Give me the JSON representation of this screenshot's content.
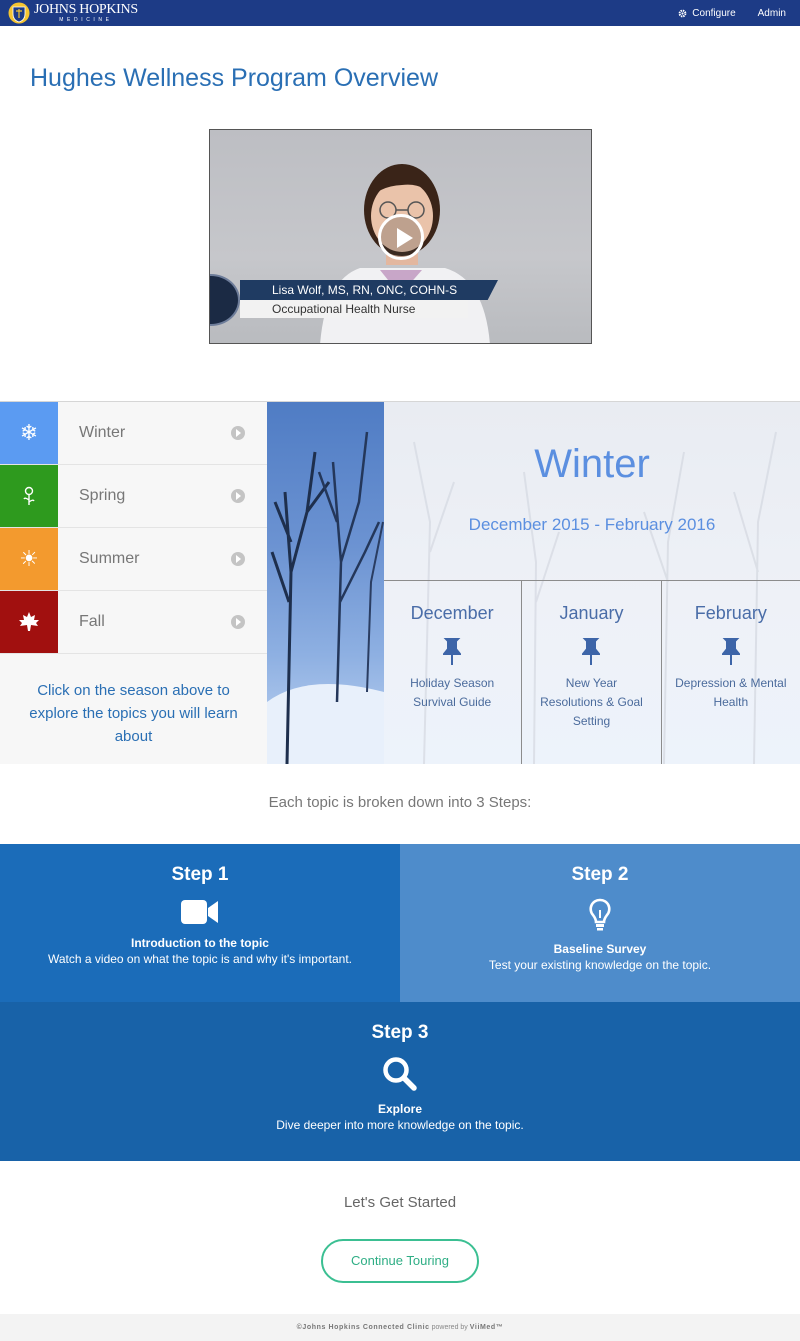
{
  "header": {
    "logo_line1": "JOHNS HOPKINS",
    "logo_line2": "MEDICINE",
    "nav": [
      {
        "label": "Configure",
        "icon": "gear-icon"
      },
      {
        "label": "Admin"
      }
    ]
  },
  "page": {
    "title": "Hughes Wellness Program Overview"
  },
  "video": {
    "presenter_name": "Lisa Wolf, MS, RN, ONC, COHN-S",
    "presenter_role": "Occupational Health Nurse",
    "play_icon": "play-icon"
  },
  "seasons": {
    "items": [
      {
        "label": "Winter",
        "color": "#5b9bf2",
        "icon": "snowflake-icon",
        "glyph": "❄"
      },
      {
        "label": "Spring",
        "color": "#2e9a1e",
        "icon": "sprout-icon",
        "glyph": "🌱"
      },
      {
        "label": "Summer",
        "color": "#f39a2e",
        "icon": "sun-icon",
        "glyph": "☀"
      },
      {
        "label": "Fall",
        "color": "#a1100f",
        "icon": "maple-leaf-icon",
        "glyph": "🍁"
      }
    ],
    "hint": "Click on the season above to explore the topics you will learn about",
    "selected": {
      "title": "Winter",
      "range": "December 2015 - February 2016",
      "months": [
        {
          "name": "December",
          "topic": "Holiday Season Survival Guide"
        },
        {
          "name": "January",
          "topic": "New Year Resolutions & Goal Setting"
        },
        {
          "name": "February",
          "topic": "Depression & Mental Health"
        }
      ]
    }
  },
  "steps": {
    "intro": "Each topic is broken down into 3 Steps:",
    "items": [
      {
        "heading": "Step 1",
        "title": "Introduction to the topic",
        "desc": "Watch a video on what the topic is and why it's important.",
        "icon": "video-camera-icon"
      },
      {
        "heading": "Step 2",
        "title": "Baseline Survey",
        "desc": "Test your existing knowledge on the topic.",
        "icon": "lightbulb-icon"
      },
      {
        "heading": "Step 3",
        "title": "Explore",
        "desc": "Dive deeper into more knowledge on the topic.",
        "icon": "search-icon"
      }
    ]
  },
  "cta": {
    "heading": "Let's Get Started",
    "button": "Continue Touring"
  },
  "footer": {
    "copyright": "©Johns Hopkins Connected Clinic",
    "powered_by": "powered by",
    "vendor": "ViiMed™"
  }
}
